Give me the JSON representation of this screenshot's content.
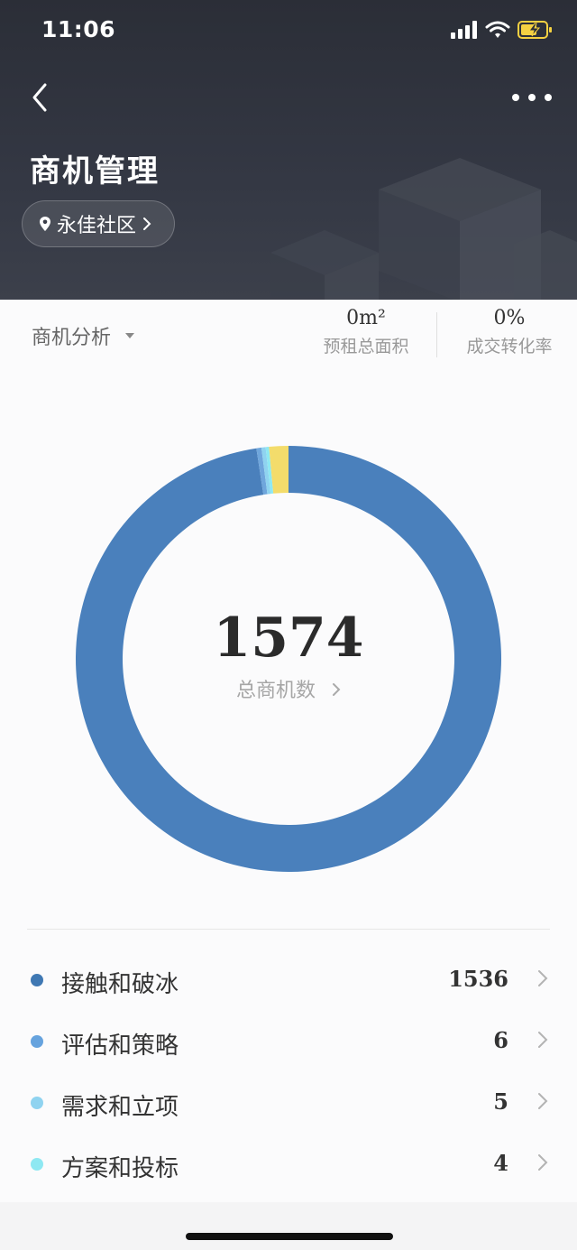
{
  "status_bar": {
    "time": "11:06"
  },
  "header": {
    "title": "商机管理",
    "location": "永佳社区"
  },
  "summary": {
    "dropdown_label": "商机分析",
    "area_value": "0m²",
    "area_label": "预租总面积",
    "rate_value": "0%",
    "rate_label": "成交转化率"
  },
  "chart_data": {
    "type": "pie",
    "center_value": "1574",
    "center_label": "总商机数",
    "categories": [
      "接触和破冰",
      "评估和策略",
      "需求和立项",
      "方案和投标",
      ""
    ],
    "values": [
      1536,
      6,
      5,
      4,
      23
    ],
    "colors": [
      "#4a80bc",
      "#6fa6dc",
      "#8fd3f0",
      "#8ee8f2",
      "#f3dc6b"
    ]
  },
  "stages": [
    {
      "name": "接触和破冰",
      "count": "1536",
      "color": "#3f78b3"
    },
    {
      "name": "评估和策略",
      "count": "6",
      "color": "#66a3de"
    },
    {
      "name": "需求和立项",
      "count": "5",
      "color": "#8fd3f0"
    },
    {
      "name": "方案和投标",
      "count": "4",
      "color": "#8ee8f2"
    }
  ]
}
